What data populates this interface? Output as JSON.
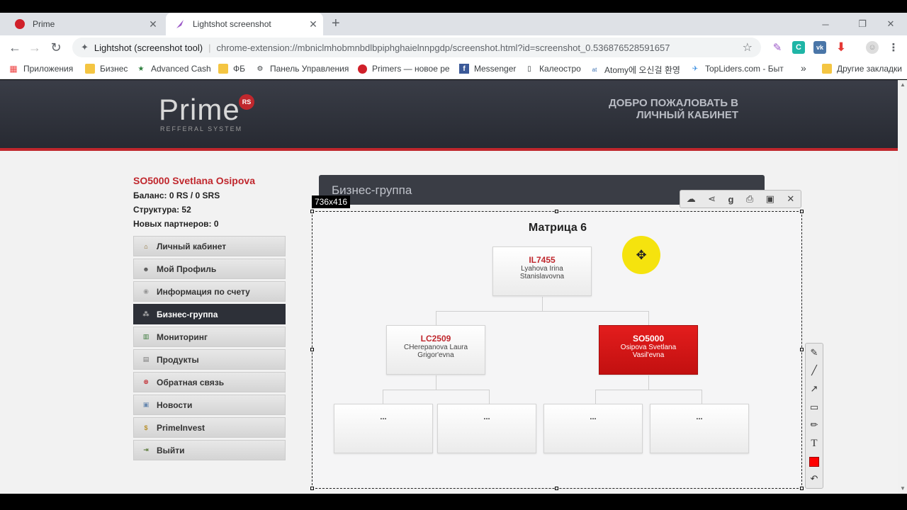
{
  "browser": {
    "tabs": [
      {
        "title": "Prime",
        "favicon": "prime-logo-icon"
      },
      {
        "title": "Lightshot screenshot",
        "favicon": "lightshot-feather-icon"
      }
    ],
    "omnibox": {
      "host": "Lightshot (screenshot tool)",
      "url": "chrome-extension://mbniclmhobmnbdlbpiphghaielnnpgdp/screenshot.html?id=screenshot_0.536876528591657"
    },
    "bookmarks": [
      "Приложения",
      "Бизнес",
      "Advanced Cash",
      "ФБ",
      "Панель Управления",
      "Primers — новое ре",
      "Messenger",
      "Калеостро",
      "Atomy에 오신걸 환영",
      "TopLiders.com - Быт",
      "»",
      "Другие закладки"
    ]
  },
  "site": {
    "logo": "Prime",
    "logo_badge": "RS",
    "logo_sub": "REFFERAL SYSTEM",
    "welcome_line1": "ДОБРО ПОЖАЛОВАТЬ В",
    "welcome_line2": "ЛИЧНЫЙ КАБИНЕТ",
    "accent": "#c0272d"
  },
  "user": {
    "name": "SO5000 Svetlana Osipova",
    "balance": "Баланс: 0 RS / 0 SRS",
    "structure": "Структура: 52",
    "new_partners": "Новых партнеров: 0"
  },
  "menu": [
    {
      "label": "Личный кабинет",
      "icon": "home-icon"
    },
    {
      "label": "Мой Профиль",
      "icon": "person-icon"
    },
    {
      "label": "Информация по счету",
      "icon": "coin-icon"
    },
    {
      "label": "Бизнес-группа",
      "icon": "group-icon",
      "active": true
    },
    {
      "label": "Мониторинг",
      "icon": "chart-icon"
    },
    {
      "label": "Продукты",
      "icon": "box-icon"
    },
    {
      "label": "Обратная связь",
      "icon": "lifebuoy-icon"
    },
    {
      "label": "Новости",
      "icon": "news-icon"
    },
    {
      "label": "PrimeInvest",
      "icon": "money-icon"
    },
    {
      "label": "Выйти",
      "icon": "exit-icon"
    }
  ],
  "content": {
    "section_title": "Бизнес-группа",
    "matrix_title": "Матрица 6",
    "nodes": {
      "top": {
        "id": "IL7455",
        "name1": "Lyahova Irina",
        "name2": "Stanislavovna"
      },
      "left": {
        "id": "LC2509",
        "name1": "CHerepanova Laura",
        "name2": "Grigor'evna"
      },
      "right": {
        "id": "SO5000",
        "name1": "Osipova Svetlana",
        "name2": "Vasil'evna"
      },
      "empty": [
        "...",
        "...",
        "...",
        "..."
      ]
    }
  },
  "lightshot": {
    "dimensions": "736x416",
    "top_tools": [
      "upload-icon",
      "share-icon",
      "google-search-icon",
      "print-icon",
      "save-icon",
      "close-icon"
    ],
    "side_tools": [
      "pen-icon",
      "line-icon",
      "arrow-icon",
      "rectangle-icon",
      "marker-icon",
      "text-icon",
      "color-icon",
      "undo-icon"
    ],
    "color": "#ff0000"
  }
}
